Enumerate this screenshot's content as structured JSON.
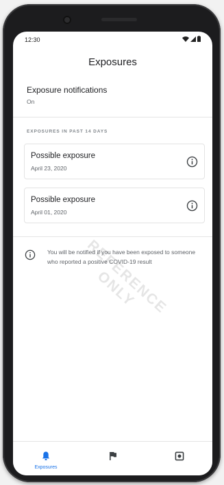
{
  "status_bar": {
    "time": "12:30"
  },
  "header": {
    "title": "Exposures"
  },
  "notifications": {
    "title": "Exposure notifications",
    "status": "On"
  },
  "exposures_section": {
    "label": "EXPOSURES IN PAST 14 DAYS"
  },
  "exposures": [
    {
      "title": "Possible exposure",
      "date": "April 23, 2020",
      "icon": "info-icon"
    },
    {
      "title": "Possible exposure",
      "date": "April 01, 2020",
      "icon": "info-icon"
    }
  ],
  "info_message": {
    "icon": "info-icon",
    "text": "You will be notified if you have been exposed to someone who reported a positive COVID-19 result"
  },
  "bottom_nav": {
    "items": [
      {
        "label": "Exposures",
        "icon": "bell-icon",
        "active": true
      },
      {
        "label": "",
        "icon": "flag-icon",
        "active": false
      },
      {
        "label": "",
        "icon": "settings-icon",
        "active": false
      }
    ]
  },
  "watermark": {
    "line1": "REFERENCE",
    "line2": "ONLY"
  },
  "colors": {
    "accent": "#1a73e8",
    "text_primary": "#202124",
    "text_secondary": "#5f6368",
    "divider": "#e4e4e4"
  }
}
